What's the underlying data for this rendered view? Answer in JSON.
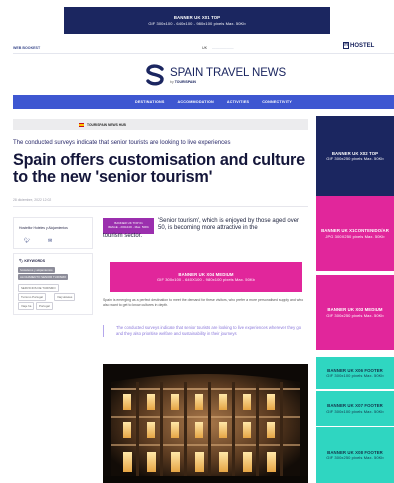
{
  "top_banner": {
    "title": "BANNER UK X01 TOP",
    "spec": "GIF 300x100 - 640x100 - 980x100 pixels Max. 50Kb"
  },
  "utility": {
    "left_link": "WEB BOOKEST",
    "lang_active": "UK",
    "lang_other": "——————",
    "hostel_logo": "HOSTEL"
  },
  "logo": {
    "title": "SPAIN TRAVEL NEWS",
    "sub_prefix": "by",
    "sub_brand": "TOURISPAIN"
  },
  "nav": {
    "items": [
      "DESTINATIONS",
      "ACCOMMODATION",
      "ACTIVITIES",
      "CONNECTIVITY"
    ]
  },
  "article": {
    "section": "TOURISPAIN NEWS HUB",
    "subhead": "The conducted surveys indicate that senior tourists are looking to live experiences",
    "headline": "Spain offers customisation and culture to the new 'senior tourism'",
    "date": "28 diciembre, 2022 12:02",
    "intro": "'Senior tourism', which is enjoyed by those aged over 50, is becoming more attractive in the",
    "intro_cont": "tourism sector.",
    "paragraph": "Spain is emerging as a perfect destination to meet the demand for these visitors, who prefer a more personalised supply and who also want to get to know cultures in depth.",
    "quote": "The conducted surveys indicate that senior tourists are looking to live experiences wherever they go and they also prioritise welfare and sustainability in their journeys"
  },
  "author": {
    "name": "Hostelfor Hoteles y Alojamientos"
  },
  "keywords": {
    "title": "KEYWORDS",
    "tags": [
      "hosteleros y alojamientos",
      "ALOJAMIENTO SENIOR TURISMO",
      "SERVICIOS DE TURISMO",
      "Turismo Portugal",
      "Viaj Hoteles",
      "Viaje ha",
      "Portugal"
    ]
  },
  "ads": {
    "small": {
      "line1": "BANNER UK TOP 01",
      "line2": "IMAGE - 200x100 - Max. 50Kb"
    },
    "mid": {
      "title": "BANNER UK X04 MEDIUM",
      "spec": "GIF 300x100 - 640X100 - 980x100 pixels Max. 50Kb"
    },
    "right": [
      {
        "title": "BANNER UK X02 TOP",
        "spec": "GIF 300x250 pixels Max. 50Kb"
      },
      {
        "title": "BANNER UK X1CONTENIDO/AR",
        "spec": "JPG 300X250 pixels Max. 50Kb"
      },
      {
        "title": "BANNER UK X03 MEDIUM",
        "spec": "GIF 300x250 pixels Max. 50Kb"
      },
      {
        "title": "BANNER UK X06 FOOTER",
        "spec": "GIF 300x100 pixels Max. 50Kb"
      },
      {
        "title": "BANNER UK X07 FOOTER",
        "spec": "GIF 300x100 pixels Max. 50Kb"
      },
      {
        "title": "BANNER UK X08 FOOTER",
        "spec": "GIF 300x250 pixels Max. 50Kb"
      }
    ]
  },
  "colors": {
    "navy": "#1b2660",
    "nav_blue": "#3e57d1",
    "magenta": "#e1269b",
    "teal": "#2fd6c1",
    "quote": "#8a78da"
  }
}
